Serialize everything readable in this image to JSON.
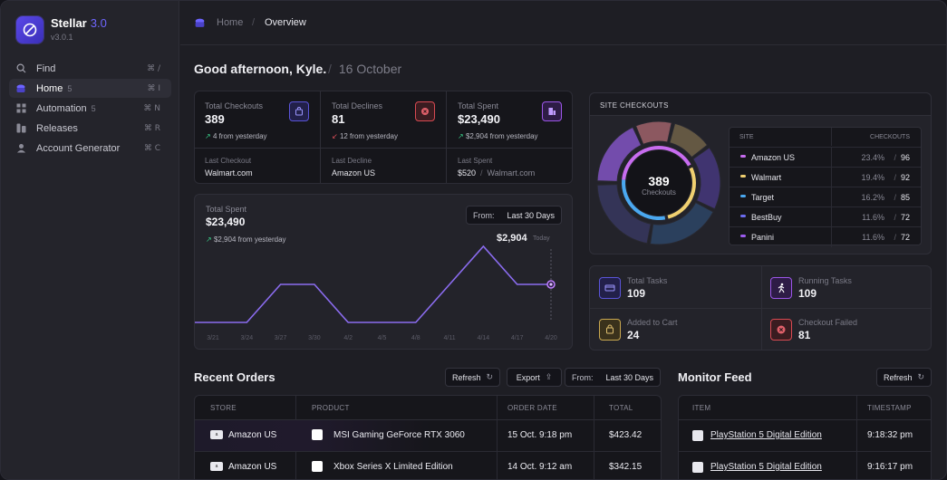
{
  "app": {
    "name": "Stellar",
    "version_badge": "3.0",
    "version": "v3.0.1"
  },
  "sidebar": {
    "items": [
      {
        "label": "Find",
        "count": "",
        "shortcut": "⌘ /",
        "icon": "search-icon"
      },
      {
        "label": "Home",
        "count": "5",
        "shortcut": "⌘ I",
        "icon": "home-icon"
      },
      {
        "label": "Automation",
        "count": "5",
        "shortcut": "⌘ N",
        "icon": "automation-icon"
      },
      {
        "label": "Releases",
        "count": "",
        "shortcut": "⌘ R",
        "icon": "releases-icon"
      },
      {
        "label": "Account Generator",
        "count": "",
        "shortcut": "⌘ C",
        "icon": "account-generator-icon"
      }
    ]
  },
  "breadcrumb": {
    "home": "Home",
    "separator": "/",
    "current": "Overview"
  },
  "greeting": {
    "text": "Good afternoon, Kyle.",
    "separator": "/",
    "date": "16 October"
  },
  "stats": [
    {
      "label": "Total Checkouts",
      "value": "389",
      "change": "4 from yesterday",
      "sub_label": "Last Checkout",
      "sub_value": "Walmart.com",
      "sub_extra": "",
      "accent": "#6c63ff"
    },
    {
      "label": "Total Declines",
      "value": "81",
      "change": "12 from yesterday",
      "sub_label": "Last Decline",
      "sub_value": "Amazon US",
      "sub_extra": "",
      "accent": "#e0505a"
    },
    {
      "label": "Total Spent",
      "value": "$23,490",
      "change": "$2,904 from yesterday",
      "sub_label": "Last Spent",
      "sub_value": "$520",
      "sub_extra": "Walmart.com",
      "accent": "#a45cf0"
    }
  ],
  "spent_chart": {
    "label": "Total Spent",
    "value": "$23,490",
    "change": "$2,904 from yesterday",
    "from_label": "From:",
    "range": "Last 30 Days",
    "current_value": "$2,904",
    "current_label": "Today"
  },
  "chart_data": {
    "type": "line",
    "categories": [
      "3/21",
      "3/24",
      "3/27",
      "3/30",
      "4/2",
      "4/5",
      "4/8",
      "4/11",
      "4/14",
      "4/17",
      "4/20"
    ],
    "values": [
      0,
      0,
      1,
      1,
      0,
      0,
      0,
      1,
      2,
      1,
      1
    ],
    "title": "",
    "xlabel": "",
    "ylabel": "",
    "grid": false,
    "color": "#8b6cf0"
  },
  "site_checkouts": {
    "title": "SITE CHECKOUTS",
    "total": "389",
    "total_label": "Checkouts",
    "col_site": "SITE",
    "col_checkouts": "CHECKOUTS",
    "rows": [
      {
        "name": "Amazon US",
        "pct": "23.4%",
        "count": "96",
        "color": "#c86cf0"
      },
      {
        "name": "Walmart",
        "pct": "19.4%",
        "count": "92",
        "color": "#f0d070"
      },
      {
        "name": "Target",
        "pct": "16.2%",
        "count": "85",
        "color": "#4aa8f0"
      },
      {
        "name": "BestBuy",
        "pct": "11.6%",
        "count": "72",
        "color": "#6c6cf0"
      },
      {
        "name": "Panini",
        "pct": "11.6%",
        "count": "72",
        "color": "#9c5cf0"
      }
    ],
    "separator": "/"
  },
  "tasks": [
    {
      "label": "Total Tasks",
      "value": "109",
      "icon": "card-icon",
      "color": "#6c63ff"
    },
    {
      "label": "Running Tasks",
      "value": "109",
      "icon": "running-icon",
      "color": "#a45cf0"
    },
    {
      "label": "Added to Cart",
      "value": "24",
      "icon": "cart-icon",
      "color": "#d0b060"
    },
    {
      "label": "Checkout Failed",
      "value": "81",
      "icon": "failed-icon",
      "color": "#e0505a"
    }
  ],
  "recent_orders": {
    "title": "Recent Orders",
    "refresh": "Refresh",
    "export": "Export",
    "from_label": "From:",
    "range": "Last 30 Days",
    "columns": [
      "STORE",
      "PRODUCT",
      "ORDER DATE",
      "TOTAL"
    ],
    "rows": [
      {
        "store": "Amazon US",
        "product": "MSI Gaming GeForce RTX 3060",
        "date": "15 Oct. 9:18 pm",
        "total": "$423.42"
      },
      {
        "store": "Amazon US",
        "product": "Xbox Series X Limited Edition",
        "date": "14 Oct. 9:12 am",
        "total": "$342.15"
      }
    ]
  },
  "monitor_feed": {
    "title": "Monitor Feed",
    "refresh": "Refresh",
    "columns": [
      "ITEM",
      "TIMESTAMP"
    ],
    "rows": [
      {
        "item": "PlayStation 5 Digital Edition",
        "time": "9:18:32 pm"
      },
      {
        "item": "PlayStation 5 Digital Edition",
        "time": "9:16:17 pm"
      }
    ]
  }
}
